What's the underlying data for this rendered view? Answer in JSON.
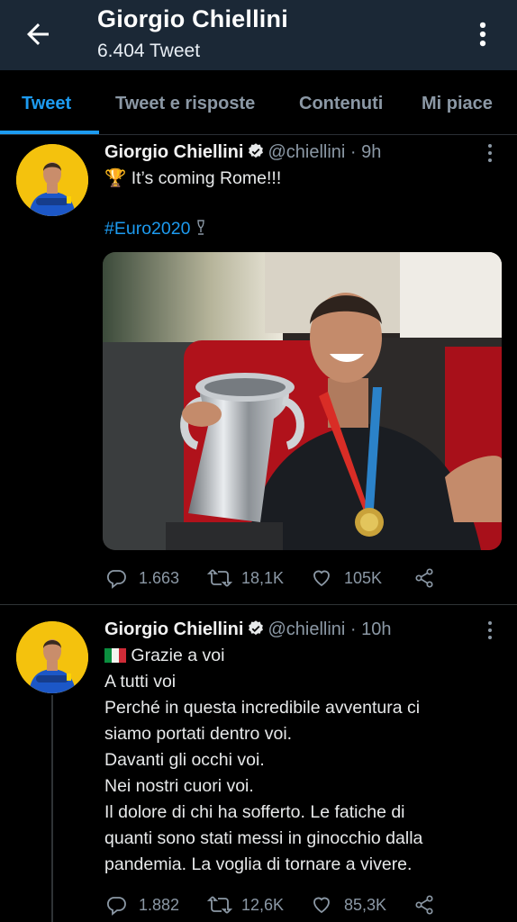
{
  "header": {
    "title": "Giorgio Chiellini",
    "subtitle": "6.404 Tweet"
  },
  "tabs": [
    {
      "label": "Tweet",
      "active": true
    },
    {
      "label": "Tweet e risposte",
      "active": false
    },
    {
      "label": "Contenuti",
      "active": false
    },
    {
      "label": "Mi piace",
      "active": false
    }
  ],
  "tweets": [
    {
      "name": "Giorgio Chiellini",
      "handle": "@chiellini · 9h",
      "emoji": "🏆",
      "text": "It’s coming Rome!!!",
      "hashtag": "#Euro2020",
      "replies": "1.663",
      "retweets": "18,1K",
      "likes": "105K"
    },
    {
      "name": "Giorgio Chiellini",
      "handle": "@chiellini · 10h",
      "first_line": "Grazie a voi",
      "lines": [
        "A tutti voi",
        "Perché in questa incredibile avventura ci",
        "siamo portati dentro voi.",
        "Davanti gli occhi voi.",
        "Nei nostri cuori voi.",
        "Il dolore di chi ha sofferto. Le fatiche di",
        "quanti sono stati messi in ginocchio dalla",
        "pandemia. La voglia di tornare a vivere."
      ],
      "replies": "1.882",
      "retweets": "12,6K",
      "likes": "85,3K"
    }
  ],
  "colors": {
    "header_bg": "#1b2836",
    "accent": "#1d9bf0",
    "muted": "#8b98a5",
    "avatar_bg": "#f4c20d"
  },
  "icons": [
    "back-arrow-icon",
    "overflow-menu-icon",
    "verified-badge-icon",
    "reply-icon",
    "retweet-icon",
    "like-icon",
    "share-icon",
    "trophy-icon",
    "italy-flag-icon"
  ]
}
